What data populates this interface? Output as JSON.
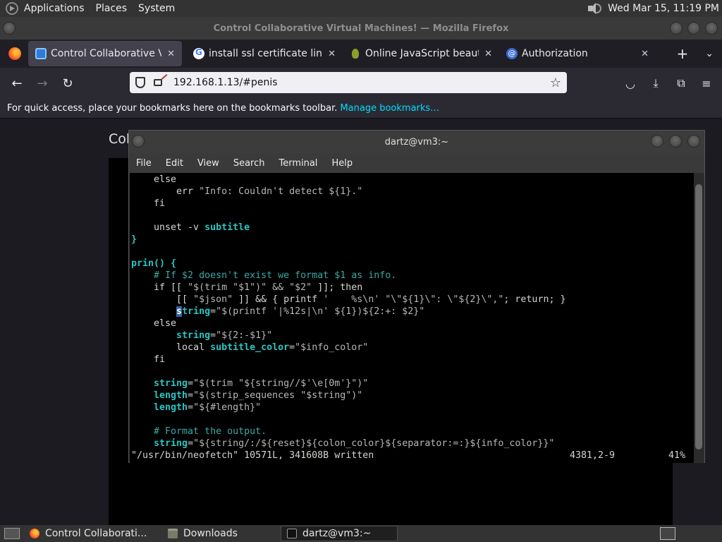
{
  "top_panel": {
    "menus": [
      "Applications",
      "Places",
      "System"
    ],
    "clock": "Wed Mar 15, 11:19 PM",
    "icons": {
      "logo": "gnome-foot-icon",
      "volume": "volume-icon"
    }
  },
  "firefox": {
    "window_title": "Control Collaborative Virtual Machines! — Mozilla Firefox",
    "tabs": [
      {
        "label": "Control Collaborative Virtua",
        "favicon": "monitor-icon",
        "active": true
      },
      {
        "label": "install ssl certificate linux - G",
        "favicon": "google-icon",
        "active": false
      },
      {
        "label": "Online JavaScript beautifier",
        "favicon": "beautifier-icon",
        "active": false
      },
      {
        "label": "Authorization",
        "favicon": "at-sign-icon",
        "active": false
      }
    ],
    "url": "192.168.1.13/#penis",
    "bookmarks_text": "For quick access, place your bookmarks here on the bookmarks toolbar.",
    "bookmarks_link": "Manage bookmarks…",
    "page_title_fragment": "Col"
  },
  "terminal": {
    "title": "dartz@vm3:~",
    "menu": [
      "File",
      "Edit",
      "View",
      "Search",
      "Terminal",
      "Help"
    ],
    "status_file": "\"/usr/bin/neofetch\" 10571L, 341608B written",
    "status_pos": "4381,2-9",
    "status_pct": "41%"
  },
  "bottom_panel": {
    "tasks": [
      {
        "label": "Control Collaborati...",
        "icon": "firefox-icon",
        "active": false
      },
      {
        "label": "Downloads",
        "icon": "folder-icon",
        "active": false
      },
      {
        "label": "dartz@vm3:~",
        "icon": "terminal-icon",
        "active": true
      }
    ]
  },
  "colors": {
    "terminal_keyword": "#2bc4c4",
    "terminal_comment": "#3aa8a8",
    "terminal_cursor": "#3465a4",
    "firefox_link": "#00ddff"
  }
}
